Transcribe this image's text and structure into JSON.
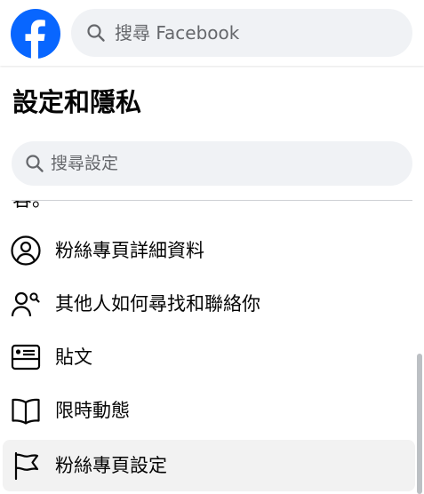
{
  "header": {
    "logo_name": "facebook-logo",
    "search_placeholder": "搜尋 Facebook"
  },
  "settings": {
    "title": "設定和隱私",
    "search_placeholder": "搜尋設定",
    "clipped_text": "容。"
  },
  "menu": {
    "items": [
      {
        "label": "粉絲專頁詳細資料",
        "icon": "profile-circle-icon",
        "active": false
      },
      {
        "label": "其他人如何尋找和聯絡你",
        "icon": "people-search-icon",
        "active": false
      },
      {
        "label": "貼文",
        "icon": "post-card-icon",
        "active": false
      },
      {
        "label": "限時動態",
        "icon": "book-icon",
        "active": false
      },
      {
        "label": "粉絲專頁設定",
        "icon": "flag-icon",
        "active": true
      }
    ]
  },
  "colors": {
    "brand": "#0866ff",
    "search_bg": "#f0f2f5",
    "active_row_bg": "#f2f2f2",
    "text_secondary": "#65676b"
  }
}
